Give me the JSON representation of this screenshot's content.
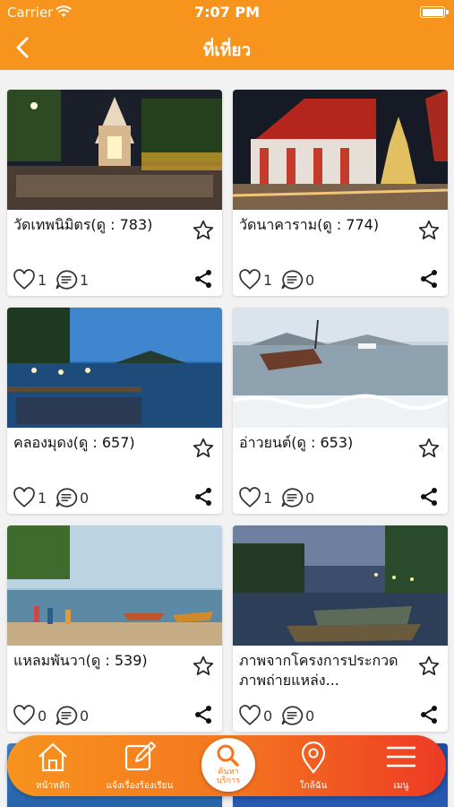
{
  "status_bar": {
    "carrier": "Carrier",
    "time": "7:07 PM"
  },
  "nav": {
    "title": "ที่เที่ยว"
  },
  "places": [
    {
      "name": "วัดเทพนิมิตร(ดู : 783)",
      "likes": "1",
      "comments": "1"
    },
    {
      "name": "วัดนาคาราม(ดู : 774)",
      "likes": "1",
      "comments": "0"
    },
    {
      "name": "คลองมุดง(ดู : 657)",
      "likes": "1",
      "comments": "0"
    },
    {
      "name": "อ่าวยนต์(ดู : 653)",
      "likes": "1",
      "comments": "0"
    },
    {
      "name": "แหลมพันวา(ดู : 539)",
      "likes": "0",
      "comments": "0"
    },
    {
      "name": "ภาพจากโครงการประกวดภาพถ่ายแหล่ง...",
      "likes": "0",
      "comments": "0"
    }
  ],
  "tabbar": {
    "home": "หน้าหลัก",
    "report": "แจ้งเรื่องร้องเรียน",
    "search_line1": "ค้นหา",
    "search_line2": "บริการ",
    "nearby": "ใกล้ฉัน",
    "menu": "เมนู"
  },
  "colors": {
    "accent": "#f7941d",
    "accent_end": "#ee3a24"
  }
}
